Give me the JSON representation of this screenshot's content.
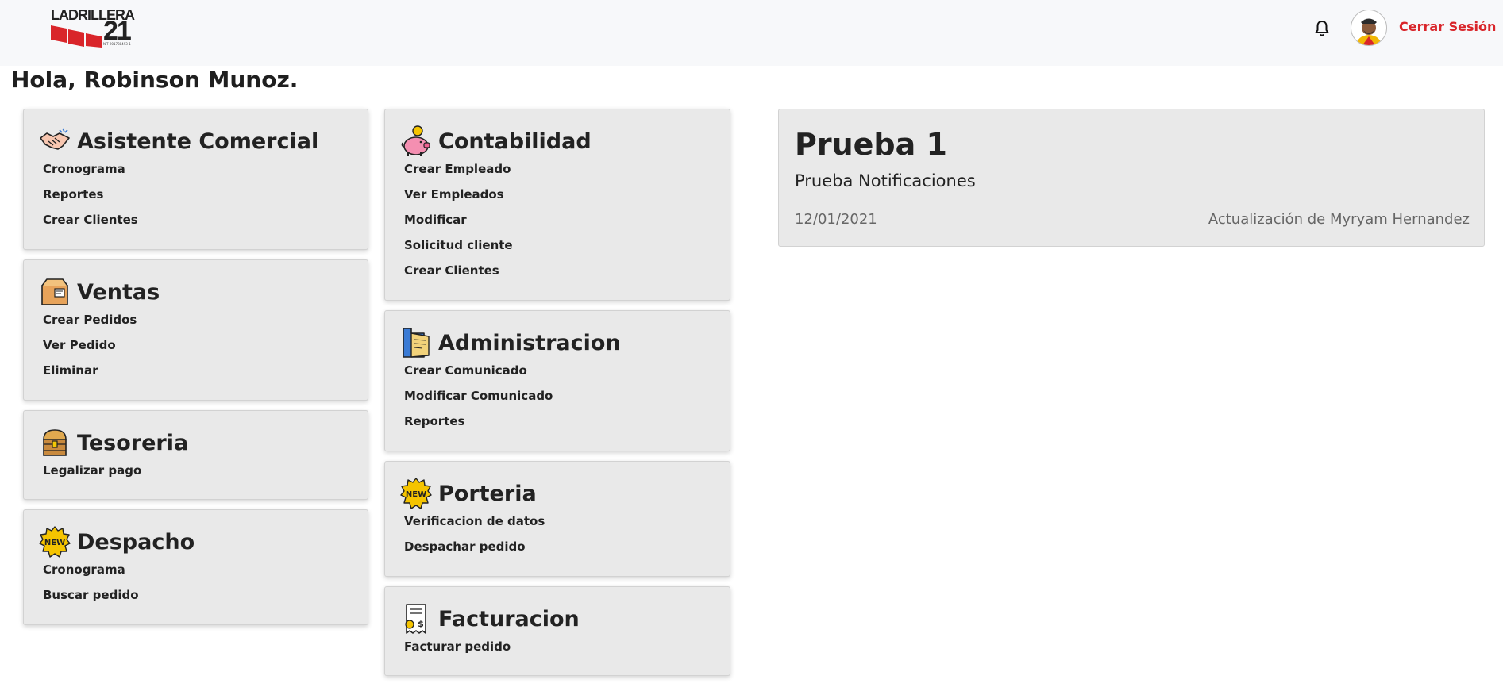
{
  "header": {
    "logo_text": "LADRILLERA",
    "logo_number": "21",
    "logo_sub": "NIT 901788493-1",
    "logout_label": "Cerrar Sesión",
    "accent": "#d9252a"
  },
  "greeting": "Hola, Robinson Munoz.",
  "modules": {
    "asistente": {
      "title": "Asistente Comercial",
      "icon": "handshake-icon",
      "links": [
        "Cronograma",
        "Reportes",
        "Crear Clientes"
      ]
    },
    "ventas": {
      "title": "Ventas",
      "icon": "box-icon",
      "links": [
        "Crear Pedidos",
        "Ver Pedido",
        "Eliminar"
      ]
    },
    "tesoreria": {
      "title": "Tesoreria",
      "icon": "treasure-chest-icon",
      "links": [
        "Legalizar pago"
      ]
    },
    "despacho": {
      "title": "Despacho",
      "icon": "new-badge-icon",
      "links": [
        "Cronograma",
        "Buscar pedido"
      ]
    },
    "contabilidad": {
      "title": "Contabilidad",
      "icon": "piggy-bank-icon",
      "links": [
        "Crear Empleado",
        "Ver Empleados",
        "Modificar",
        "Solicitud cliente",
        "Crear Clientes"
      ]
    },
    "administracion": {
      "title": "Administracion",
      "icon": "folder-icon",
      "links": [
        "Crear Comunicado",
        "Modificar Comunicado",
        "Reportes"
      ]
    },
    "porteria": {
      "title": "Porteria",
      "icon": "new-badge-icon",
      "links": [
        "Verificacion de datos",
        "Despachar pedido"
      ]
    },
    "facturacion": {
      "title": "Facturacion",
      "icon": "invoice-icon",
      "links": [
        "Facturar pedido"
      ]
    }
  },
  "notification": {
    "title": "Prueba 1",
    "subtitle": "Prueba Notificaciones",
    "date": "12/01/2021",
    "author": "Actualización de Myryam Hernandez"
  }
}
